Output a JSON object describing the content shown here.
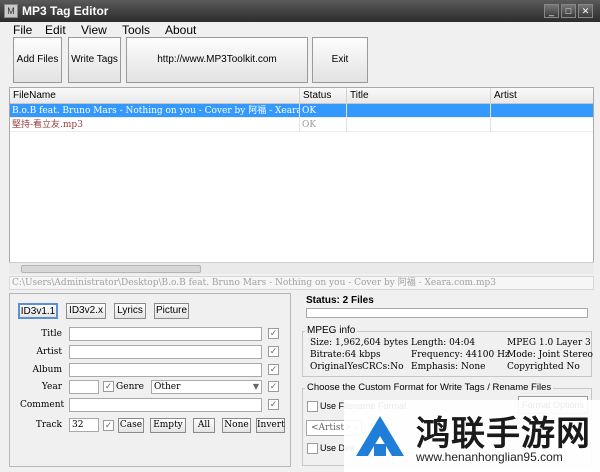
{
  "window": {
    "title": "MP3 Tag Editor",
    "app_icon": "M",
    "minimize": "_",
    "maximize": "□",
    "close": "✕"
  },
  "menu": [
    "File",
    "Edit",
    "View",
    "Tools",
    "About"
  ],
  "toolbar": {
    "add_files": "Add Files",
    "write_tags": "Write Tags",
    "url": "http://www.MP3Toolkit.com",
    "exit": "Exit"
  },
  "grid": {
    "columns": [
      "FileName",
      "Status",
      "Title",
      "Artist"
    ],
    "rows": [
      {
        "filename": "B.o.B feat. Bruno Mars - Nothing on you - Cover by 阿福 - Xeara.com.mp3",
        "status": "OK",
        "title": "",
        "artist": "",
        "selected": true
      },
      {
        "filename": "堅持-看立友.mp3",
        "status": "OK",
        "title": "",
        "artist": "",
        "selected": false
      }
    ]
  },
  "path_text": "C:\\Users\\Administrator\\Desktop\\B.o.B feat. Bruno Mars - Nothing on you - Cover by 阿福 - Xeara.com.mp3",
  "tag_tabs": [
    "ID3v1.1",
    "ID3v2.x",
    "Lyrics",
    "Picture"
  ],
  "fields": {
    "title_label": "Title",
    "artist_label": "Artist",
    "album_label": "Album",
    "year_label": "Year",
    "genre_label": "Genre",
    "genre_value": "Other",
    "comment_label": "Comment",
    "track_label": "Track",
    "track_value": "32",
    "check_mark": "✓"
  },
  "case_buttons": [
    "Case",
    "Empty",
    "All",
    "None",
    "Invert"
  ],
  "status": {
    "label": "Status: 2 Files",
    "progress": 0
  },
  "mpeg_info": {
    "group_title": "MPEG info",
    "size": "Size: 1,962,604 bytes",
    "length": "Length: 04:04",
    "layer": "MPEG 1.0 Layer 3",
    "bitrate": "Bitrate:64 kbps",
    "frequency": "Frequency: 44100 Hz",
    "mode": "Mode: Joint Stereo",
    "original": "OriginalYes",
    "crcs": "CRCs:No",
    "emphasis": "Emphasis: None",
    "copyrighted": "Copyrighted No"
  },
  "custom_format": {
    "group_title": "Choose the Custom Format for Write Tags / Rename Files",
    "use_filename": "Use Filename Format",
    "format_options": "Format Options",
    "artist_pattern": "<Artist> -",
    "use_dir": "Use Dire"
  },
  "watermark": {
    "text": "鸿联手游网",
    "url": "www.henanhonglian95.com"
  },
  "colors": {
    "selection": "#3399ff",
    "titlebar": "#3a3a3a",
    "watermark_blue": "#1f7fd8"
  }
}
